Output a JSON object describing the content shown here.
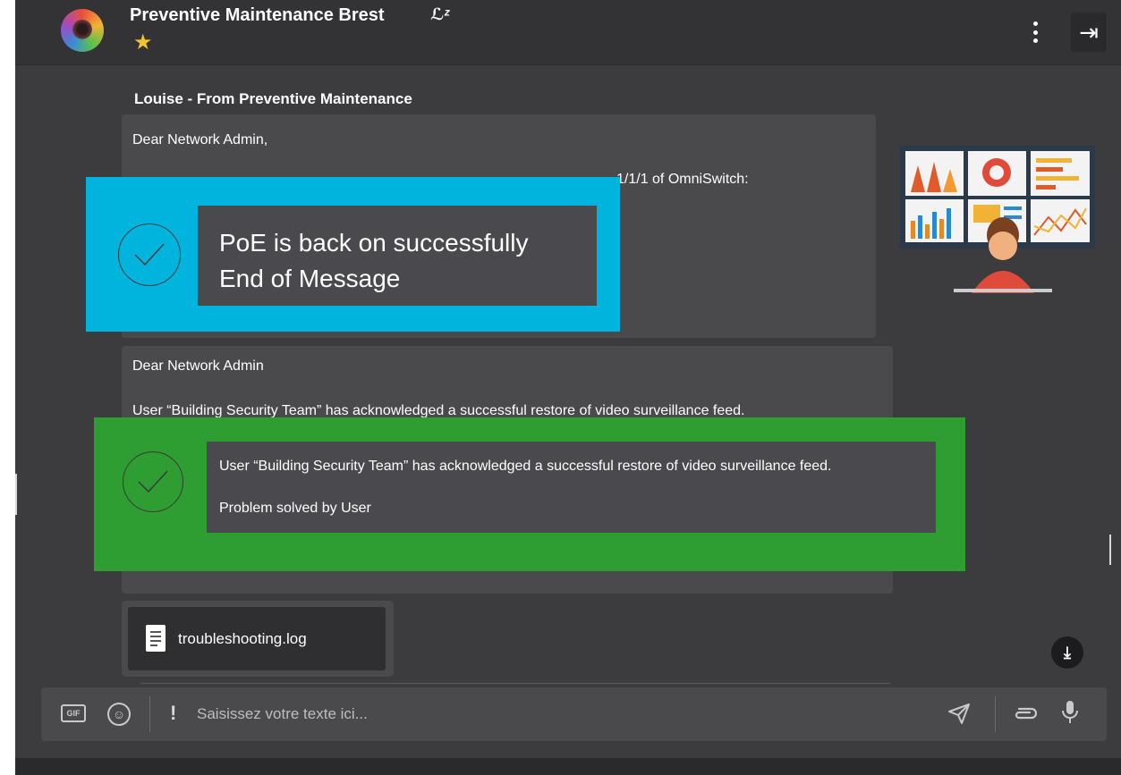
{
  "header": {
    "channel_title": "Preventive Maintenance Brest",
    "mute_icon": "snooze-icon",
    "favorite_icon": "star-icon",
    "menu_icon": "kebab-menu-icon",
    "exit_icon": "exit-right-icon"
  },
  "messages": {
    "sender": "Louise - From Preventive Maintenance",
    "first": {
      "greeting": "Dear Network Admin,",
      "partial_line_end": "1/1/1 of OmniSwitch:"
    },
    "second": {
      "greeting": "Dear Network Admin",
      "line": "User “Building Security Team” has acknowledged a successful restore of video surveillance feed."
    },
    "attachment": {
      "file_name": "troubleshooting.log",
      "icon": "text-file-icon"
    }
  },
  "overlays": {
    "blue": {
      "line1": "PoE is back on successfully",
      "line2": "End of Message",
      "color": "#00b4de"
    },
    "green": {
      "line1": "User “Building Security Team” has acknowledged a successful restore of video surveillance feed.",
      "line2": "Problem solved by User",
      "color": "#2e9e33"
    }
  },
  "composer": {
    "placeholder": "Saisissez votre texte ici...",
    "gif_label": "GIF",
    "icons": [
      "gif-icon",
      "emoji-icon",
      "priority-icon",
      "send-icon",
      "attach-icon",
      "mic-icon"
    ]
  },
  "colors": {
    "background": "#3c3c3e",
    "bubble": "#4a4a4d",
    "star": "#f4c430"
  }
}
